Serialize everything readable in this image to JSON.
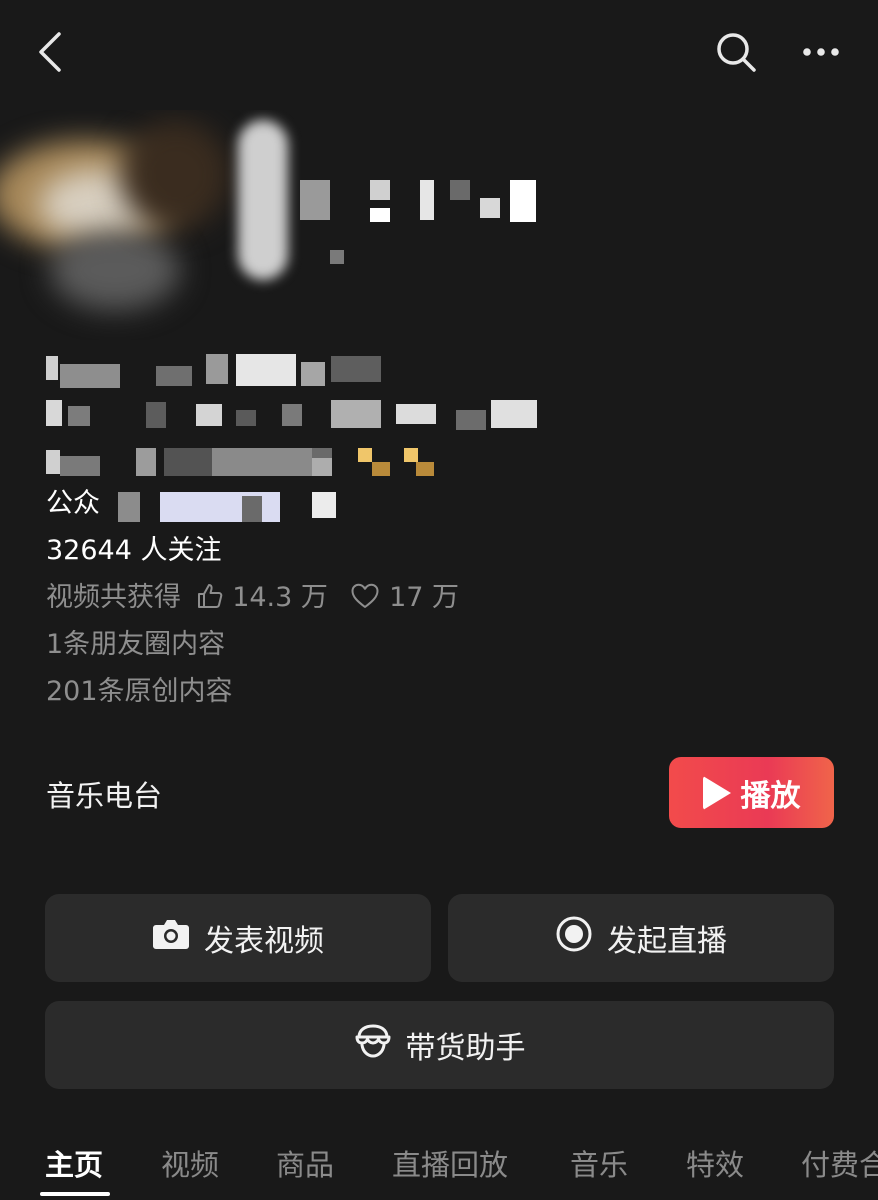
{
  "header": {
    "back_icon": "back-chevron-icon",
    "search_icon": "search-icon",
    "more_icon": "more-dots-icon"
  },
  "profile": {
    "line4_prefix": "公众",
    "followers": "32644 人关注",
    "likes_prefix": "视频共获得",
    "likes_count": "14.3 万",
    "hearts_count": "17 万",
    "moments": "1条朋友圈内容",
    "original": "201条原创内容"
  },
  "music": {
    "label": "音乐电台",
    "play_label": "播放"
  },
  "actions": {
    "publish_video": "发表视频",
    "start_live": "发起直播",
    "sales_assistant": "带货助手"
  },
  "tabs": [
    "主页",
    "视频",
    "商品",
    "直播回放",
    "音乐",
    "特效",
    "付费合"
  ],
  "colors": {
    "background": "#191919",
    "play_button": "#ee4250",
    "card": "#2b2b2b"
  }
}
